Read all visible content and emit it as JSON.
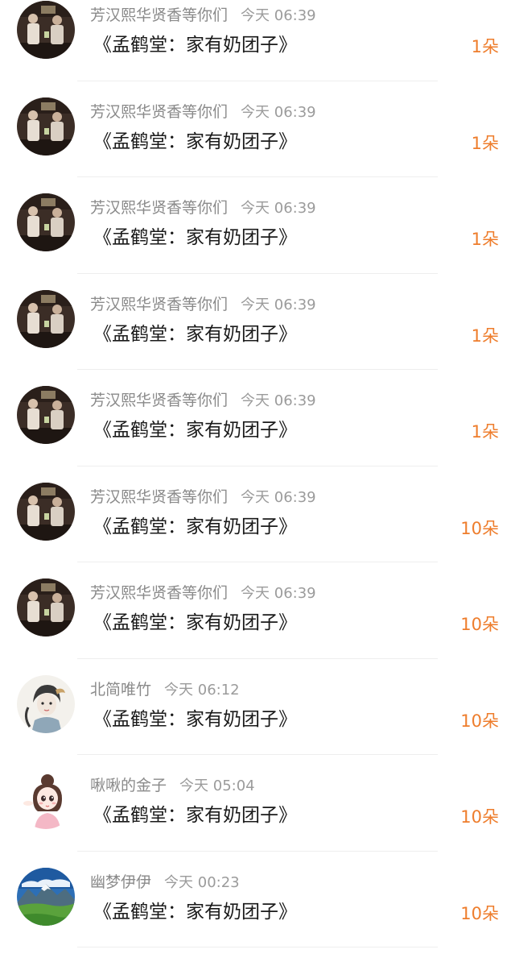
{
  "colors": {
    "username": "#8a8a8a",
    "time": "#9b9b9b",
    "title": "#1a1a1a",
    "count": "#ee7d2c",
    "divider": "#eeeeee"
  },
  "items": [
    {
      "avatar": "stage-performers-avatar",
      "user": "芳汉熙华贤香等你们",
      "time": "今天 06:39",
      "title": "《孟鹤堂：家有奶团子》",
      "count": "1朵"
    },
    {
      "avatar": "stage-performers-avatar",
      "user": "芳汉熙华贤香等你们",
      "time": "今天 06:39",
      "title": "《孟鹤堂：家有奶团子》",
      "count": "1朵"
    },
    {
      "avatar": "stage-performers-avatar",
      "user": "芳汉熙华贤香等你们",
      "time": "今天 06:39",
      "title": "《孟鹤堂：家有奶团子》",
      "count": "1朵"
    },
    {
      "avatar": "stage-performers-avatar",
      "user": "芳汉熙华贤香等你们",
      "time": "今天 06:39",
      "title": "《孟鹤堂：家有奶团子》",
      "count": "1朵"
    },
    {
      "avatar": "stage-performers-avatar",
      "user": "芳汉熙华贤香等你们",
      "time": "今天 06:39",
      "title": "《孟鹤堂：家有奶团子》",
      "count": "1朵"
    },
    {
      "avatar": "stage-performers-avatar",
      "user": "芳汉熙华贤香等你们",
      "time": "今天 06:39",
      "title": "《孟鹤堂：家有奶团子》",
      "count": "10朵"
    },
    {
      "avatar": "stage-performers-avatar",
      "user": "芳汉熙华贤香等你们",
      "time": "今天 06:39",
      "title": "《孟鹤堂：家有奶团子》",
      "count": "10朵"
    },
    {
      "avatar": "ink-portrait-avatar",
      "user": "北简唯竹",
      "time": "今天 06:12",
      "title": "《孟鹤堂：家有奶团子》",
      "count": "10朵"
    },
    {
      "avatar": "cartoon-girl-avatar",
      "user": "啾啾的金子",
      "time": "今天 05:04",
      "title": "《孟鹤堂：家有奶团子》",
      "count": "10朵"
    },
    {
      "avatar": "mountain-landscape-avatar",
      "user": "幽梦伊伊",
      "time": "今天 00:23",
      "title": "《孟鹤堂：家有奶团子》",
      "count": "10朵"
    }
  ]
}
